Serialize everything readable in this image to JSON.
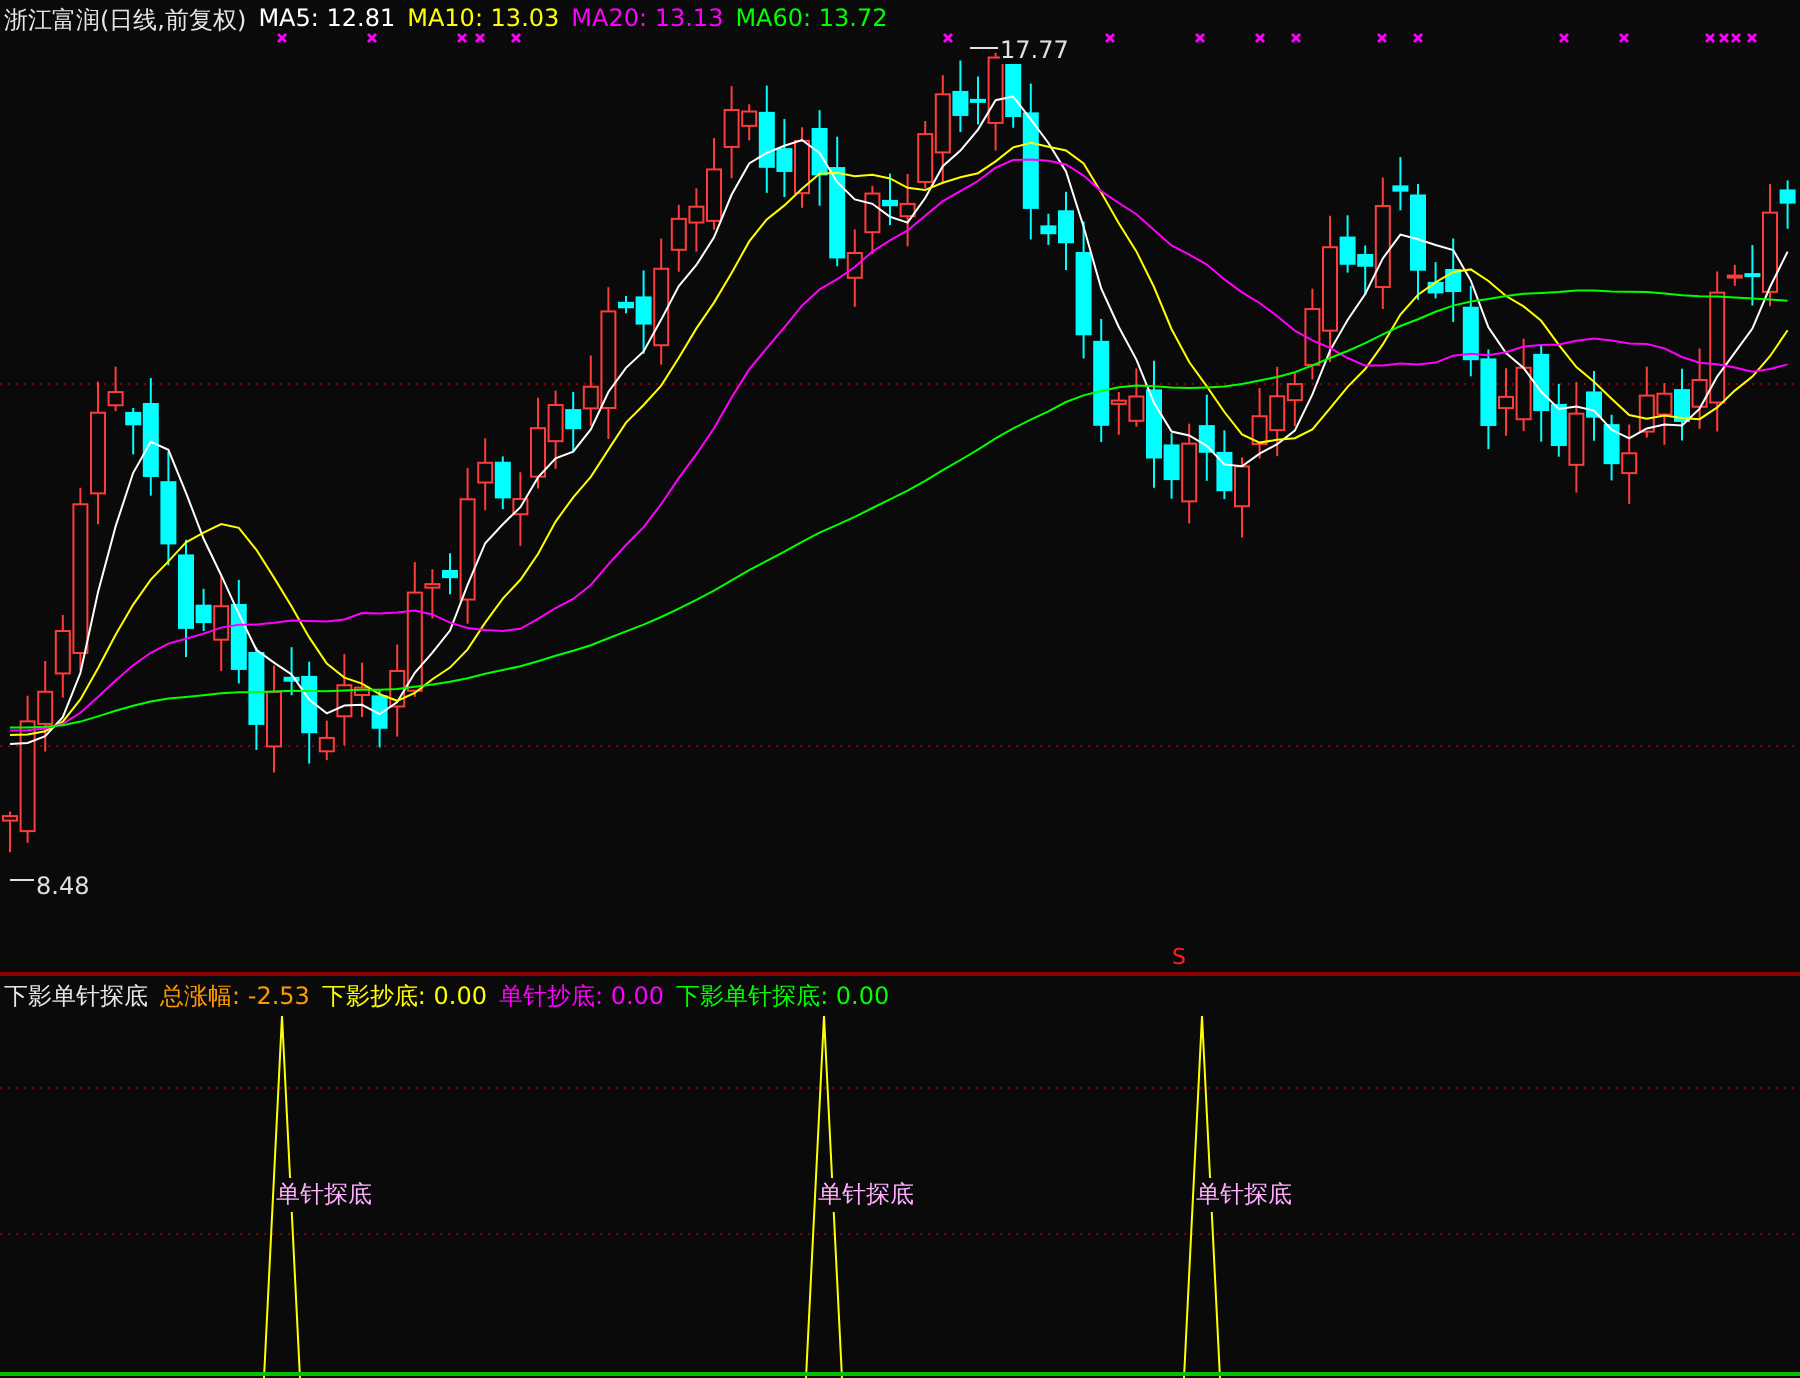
{
  "main_panel": {
    "title": "浙江富润(日线,前复权)",
    "indicators": [
      {
        "text": "MA5: 12.81",
        "color": "#ffffff"
      },
      {
        "text": "MA10: 13.03",
        "color": "#ffff00"
      },
      {
        "text": "MA20: 13.13",
        "color": "#ff00ff"
      },
      {
        "text": "MA60: 13.72",
        "color": "#00ff00"
      }
    ],
    "high_label": "17.77",
    "low_label": "8.48",
    "signal_mark": "S"
  },
  "sub_panel": {
    "title": "下影单针探底",
    "indicators": [
      {
        "text": "总涨幅: -2.53",
        "color": "#ff9900"
      },
      {
        "text": "下影抄底: 0.00",
        "color": "#ffff00"
      },
      {
        "text": "单针抄底: 0.00",
        "color": "#ff00ff"
      },
      {
        "text": "下影单针探底: 0.00",
        "color": "#00ff00"
      }
    ],
    "signals": [
      {
        "label": "单针探底"
      },
      {
        "label": "单针探底"
      },
      {
        "label": "单针探底"
      }
    ]
  }
}
